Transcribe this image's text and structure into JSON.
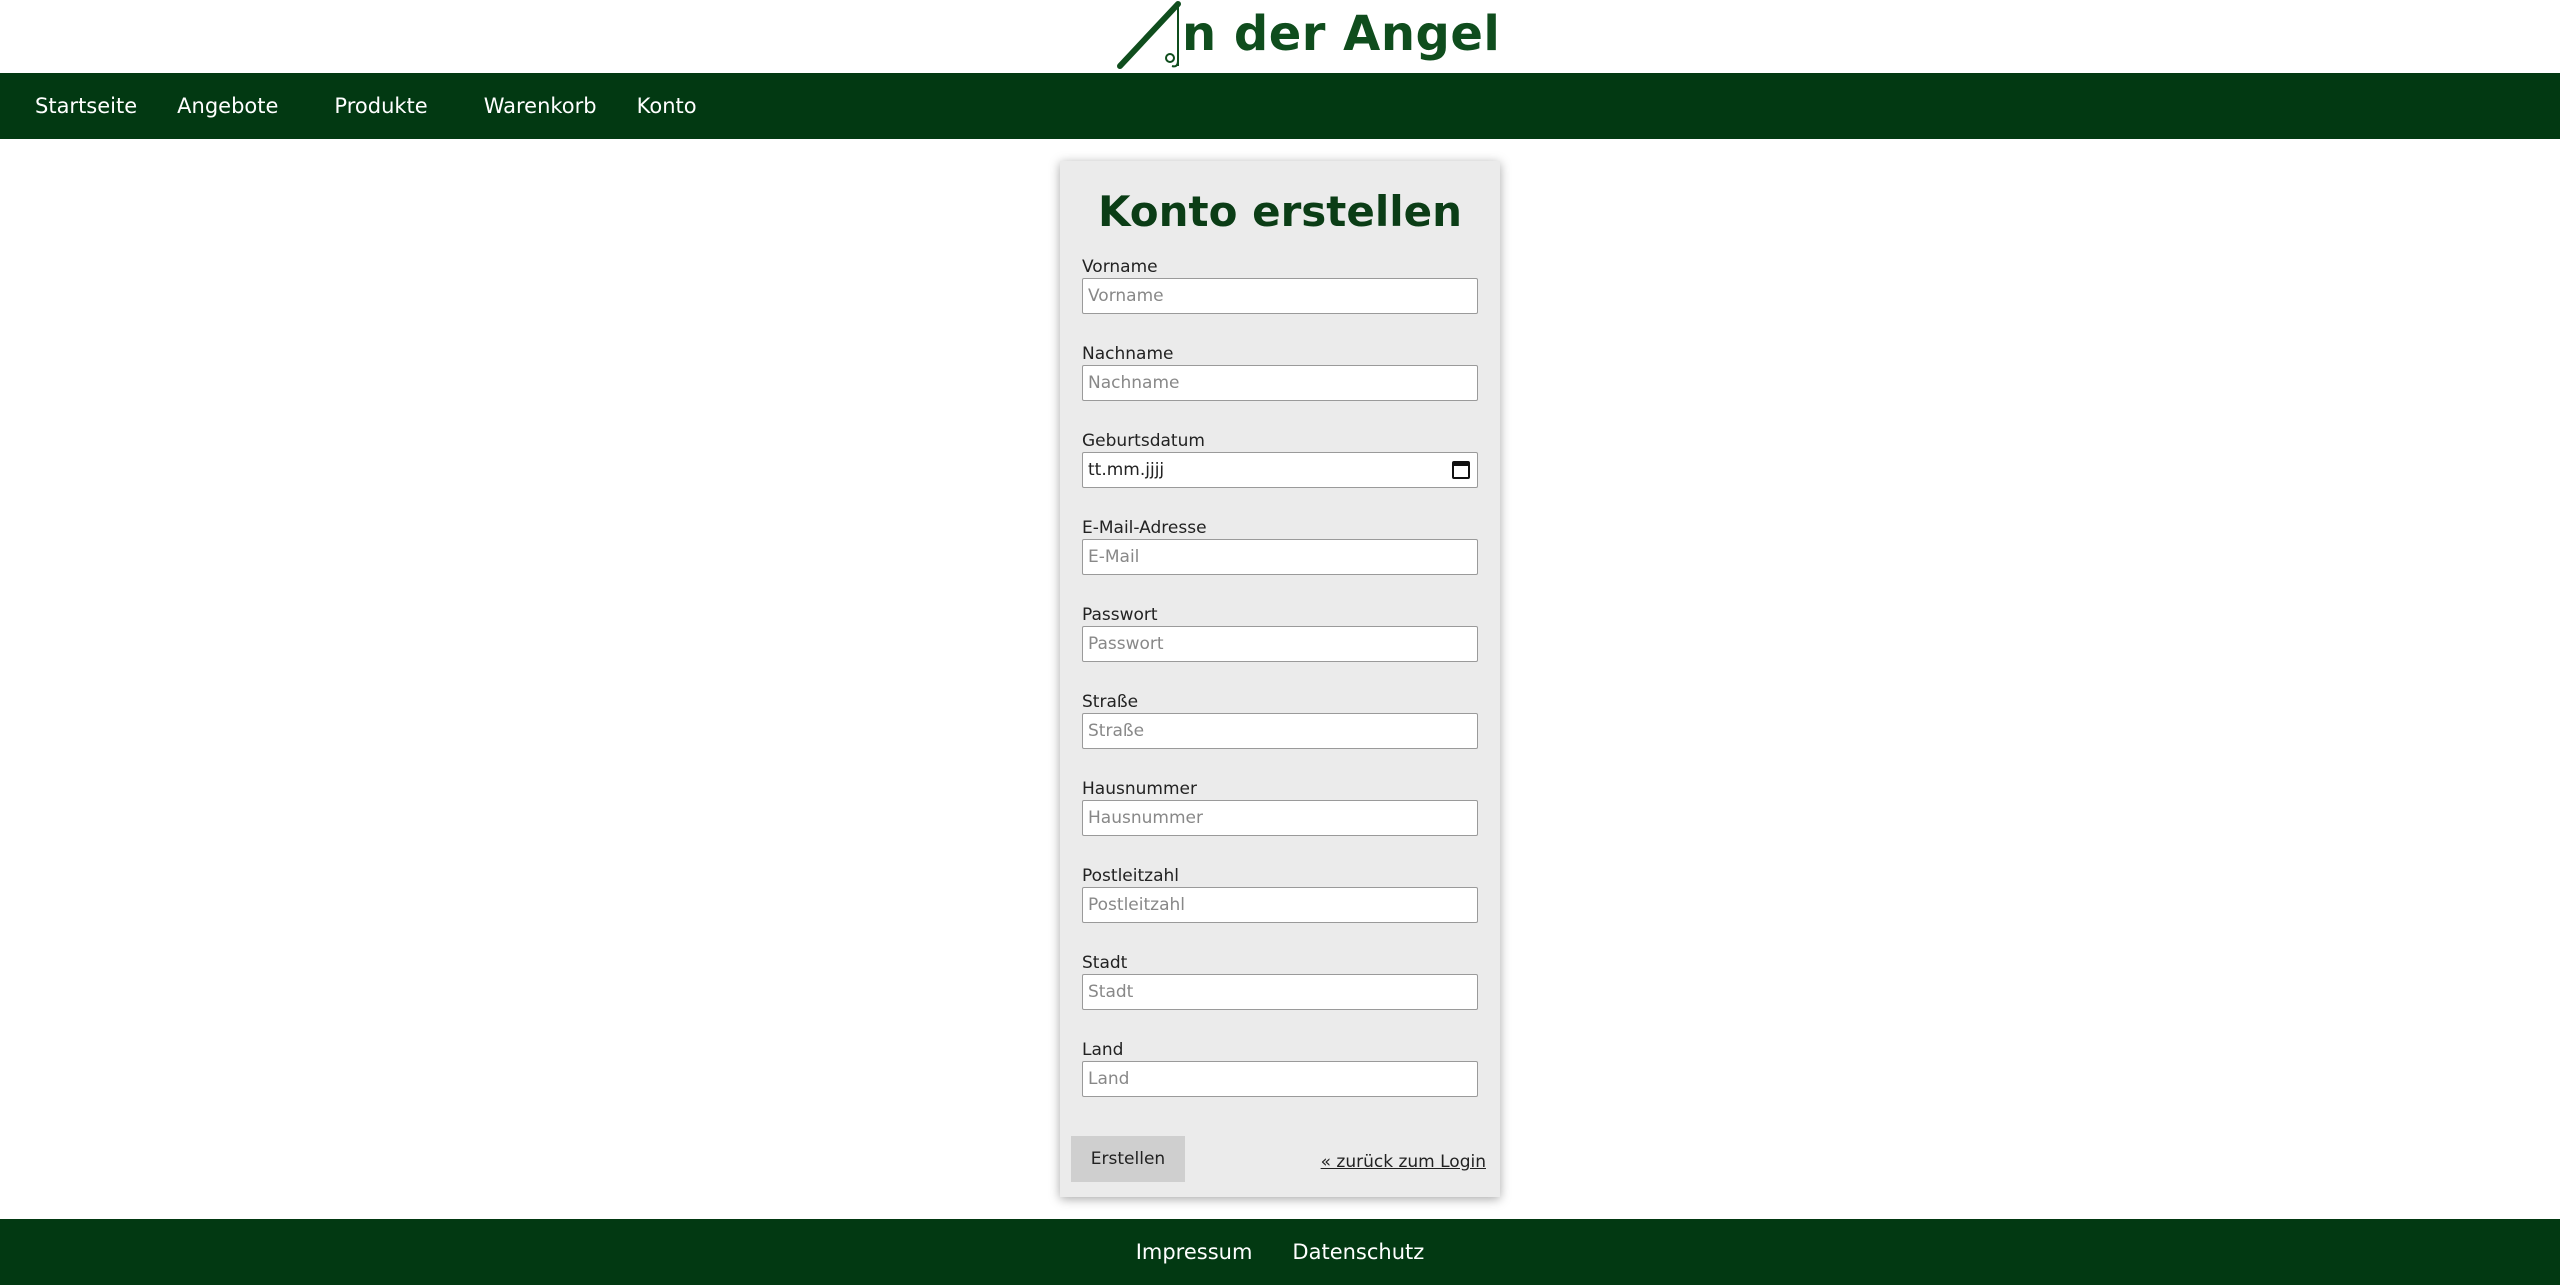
{
  "brand": {
    "logo_text": "n der Angel",
    "logo_icon": "fishing-rod-icon",
    "color": "#0f4d1d"
  },
  "nav": {
    "items": [
      {
        "label": "Startseite"
      },
      {
        "label": "Angebote"
      },
      {
        "label": "Produkte"
      },
      {
        "label": "Warenkorb"
      },
      {
        "label": "Konto"
      }
    ],
    "background": "#023912"
  },
  "form": {
    "title": "Konto erstellen",
    "fields": [
      {
        "label": "Vorname",
        "placeholder": "Vorname"
      },
      {
        "label": "Nachname",
        "placeholder": "Nachname"
      },
      {
        "label": "Geburtsdatum",
        "value": "tt.mm.jjjj"
      },
      {
        "label": "E-Mail-Adresse",
        "placeholder": "E-Mail"
      },
      {
        "label": "Passwort",
        "placeholder": "Passwort"
      },
      {
        "label": "Straße",
        "placeholder": "Straße"
      },
      {
        "label": "Hausnummer",
        "placeholder": "Hausnummer"
      },
      {
        "label": "Postleitzahl",
        "placeholder": "Postleitzahl"
      },
      {
        "label": "Stadt",
        "placeholder": "Stadt"
      },
      {
        "label": "Land",
        "placeholder": "Land"
      }
    ],
    "submit_label": "Erstellen",
    "back_link": "« zurück zum Login"
  },
  "footer": {
    "links": [
      {
        "label": "Impressum"
      },
      {
        "label": "Datenschutz"
      }
    ]
  }
}
